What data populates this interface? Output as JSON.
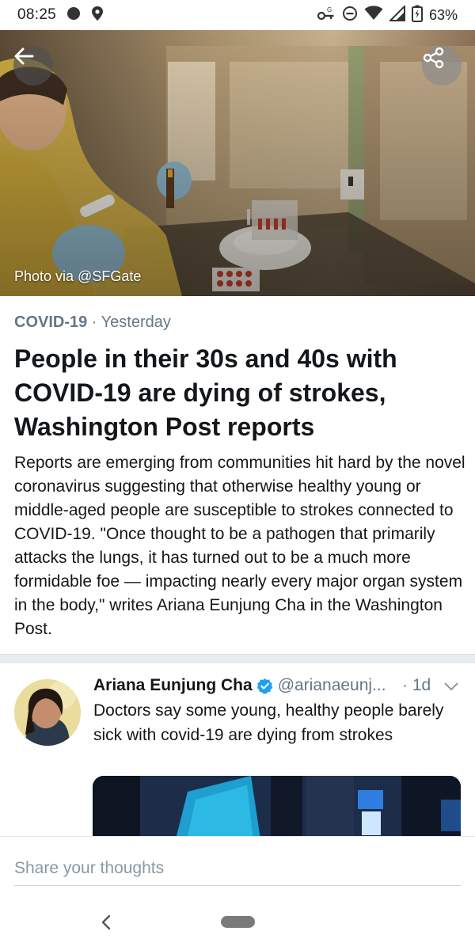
{
  "status_bar": {
    "time": "08:25",
    "battery": "63%",
    "icons": [
      "chat-bubble-icon",
      "location-icon",
      "vpn-key-icon",
      "do-not-disturb-icon",
      "wifi-icon",
      "signal-icon",
      "battery-icon"
    ]
  },
  "hero": {
    "photo_credit": "Photo via @SFGate",
    "back_icon": "arrow-left-icon",
    "share_icon": "share-icon"
  },
  "article": {
    "category": "COVID-19",
    "separator": " · ",
    "date": "Yesterday",
    "headline": "People in their 30s and 40s with COVID-19 are dying of strokes, Washington Post reports",
    "summary": "Reports are emerging from communities hit hard by the novel coronavirus suggesting that otherwise healthy young or middle-aged people are susceptible to strokes connected to COVID-19. \"Once thought to be a pathogen that primarily attacks the lungs, it has turned out to be a much more formidable foe — impacting nearly every major organ system in the body,\" writes Ariana Eunjung Cha in the Washington Post."
  },
  "tweet": {
    "name": "Ariana Eunjung Cha",
    "handle": "@arianaeunj...",
    "time": "· 1d",
    "text": "Doctors say some young, healthy people barely sick with covid-19 are dying from strokes"
  },
  "compose": {
    "placeholder": "Share your thoughts"
  },
  "colors": {
    "text": "#14171a",
    "secondary": "#657786",
    "verified": "#1da1f2",
    "divider": "#e6ecf0"
  }
}
